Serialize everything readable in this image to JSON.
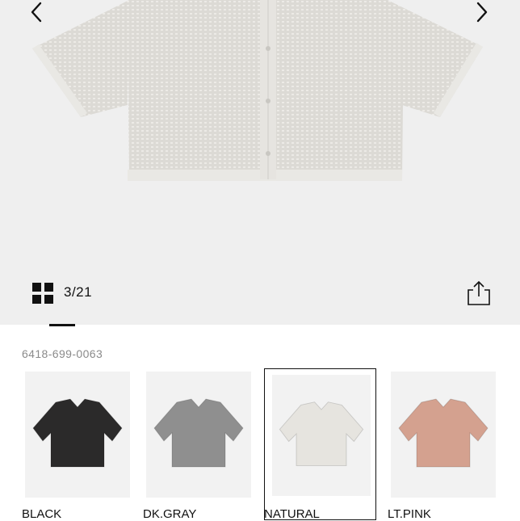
{
  "gallery": {
    "counter": "3/21",
    "image_icon": "cardigan-photo",
    "prev_icon": "chevron-left-icon",
    "next_icon": "chevron-right-icon",
    "grid_icon": "grid-icon",
    "share_icon": "share-icon"
  },
  "product": {
    "code": "6418-699-0063"
  },
  "colors": [
    {
      "label": "BLACK",
      "color": "#2b2a2a",
      "selected": false
    },
    {
      "label": "DK.GRAY",
      "color": "#8f8f8f",
      "selected": false
    },
    {
      "label": "NATURAL",
      "color": "#e6e4df",
      "selected": true
    },
    {
      "label": "LT.PINK",
      "color": "#d4a18f",
      "selected": false
    }
  ]
}
